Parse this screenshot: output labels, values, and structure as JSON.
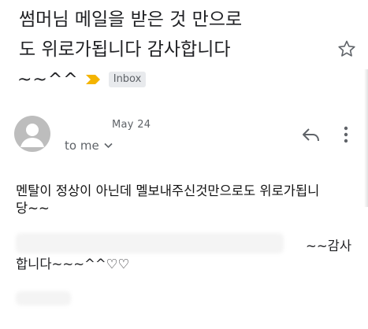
{
  "email": {
    "subject_line_1": "썸머님 메일을 받은 것 만으로",
    "subject_line_2": "도 위로가됩니다 감사합니다",
    "subject_line_3": "~~^^",
    "label": "Inbox",
    "date": "May 24",
    "recipient": "to me",
    "body_line_1": "멘탈이 정상이 아닌데 멜보내주신것만으로도 위로가됩니",
    "body_line_2": "당~~",
    "body_line_3_end": "~~감사",
    "body_line_4": "합니다~~~^^♡♡"
  },
  "icons": {
    "star": "star-outline-icon",
    "important": "important-marker-icon",
    "avatar": "person-avatar-icon",
    "reply": "reply-icon",
    "more": "more-vert-icon",
    "chevron": "chevron-down-icon"
  },
  "colors": {
    "important": "#f4b400",
    "avatar_bg": "#bdbdbd",
    "chip_bg": "#e8eaed",
    "secondary_text": "#5f6368"
  }
}
